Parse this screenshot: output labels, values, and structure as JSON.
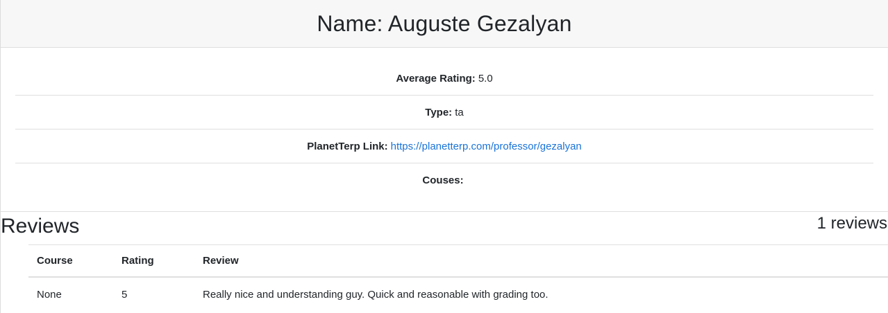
{
  "header": {
    "title": "Name: Auguste Gezalyan"
  },
  "info": {
    "average_rating_label": "Average Rating:",
    "average_rating_value": "5.0",
    "type_label": "Type:",
    "type_value": "ta",
    "planetterp_label": "PlanetTerp Link:",
    "planetterp_link": "https://planetterp.com/professor/gezalyan",
    "courses_label": "Couses:"
  },
  "reviews": {
    "title": "Reviews",
    "count_text": "1 reviews",
    "columns": [
      "Course",
      "Rating",
      "Review"
    ],
    "rows": [
      {
        "course": "None",
        "rating": "5",
        "review": "Really nice and understanding guy. Quick and reasonable with grading too."
      }
    ]
  },
  "colors": {
    "link": "#1a73d8",
    "header_bg": "#f7f7f7",
    "border": "#dfdfdf"
  }
}
